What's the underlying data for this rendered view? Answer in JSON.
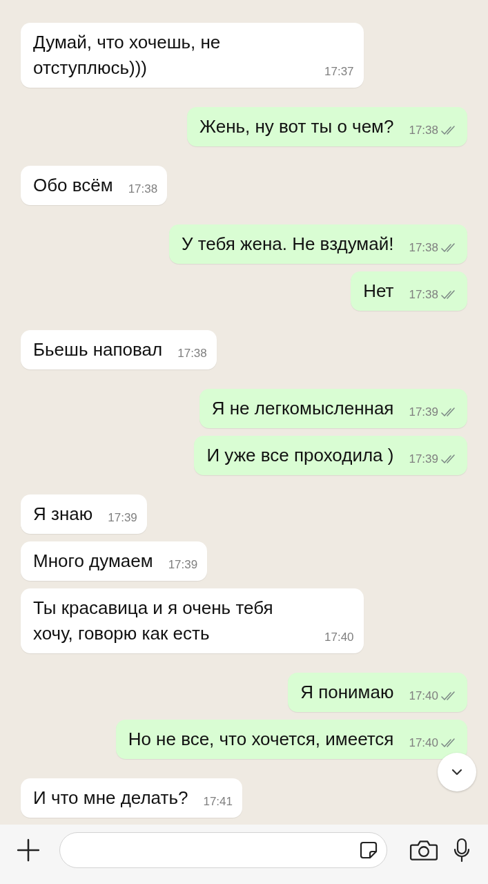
{
  "messages": [
    {
      "kind": "in",
      "text": "Думай, что хочешь, не отступлюсь)))",
      "time": "17:37"
    },
    {
      "kind": "out",
      "text": "Жень, ну вот ты о чем?",
      "time": "17:38"
    },
    {
      "kind": "in",
      "text": "Обо всём",
      "time": "17:38"
    },
    {
      "kind": "out",
      "text": "У тебя жена. Не вздумай!",
      "time": "17:38"
    },
    {
      "kind": "out",
      "text": "Нет",
      "time": "17:38"
    },
    {
      "kind": "in",
      "text": "Бьешь наповал",
      "time": "17:38"
    },
    {
      "kind": "out",
      "text": "Я не легкомысленная",
      "time": "17:39"
    },
    {
      "kind": "out",
      "text": "И уже все проходила )",
      "time": "17:39"
    },
    {
      "kind": "in",
      "text": "Я знаю",
      "time": "17:39"
    },
    {
      "kind": "in",
      "text": "Много думаем",
      "time": "17:39"
    },
    {
      "kind": "in",
      "text": "Ты красавица и я очень тебя хочу, говорю как есть",
      "time": "17:40"
    },
    {
      "kind": "out",
      "text": "Я понимаю",
      "time": "17:40"
    },
    {
      "kind": "out",
      "text": "Но не все, что хочется, имеется",
      "time": "17:40"
    },
    {
      "kind": "in",
      "text": "И что мне делать?",
      "time": "17:41"
    }
  ]
}
